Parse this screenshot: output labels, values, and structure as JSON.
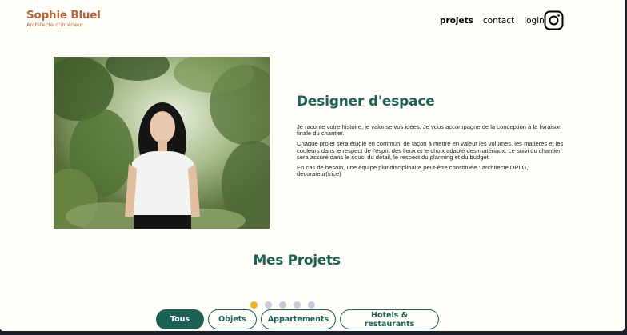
{
  "header": {
    "logo_name": "Sophie Bluel",
    "logo_subtitle": "Architecte d'intérieur",
    "nav": [
      {
        "label": "projets",
        "active": true
      },
      {
        "label": "contact",
        "active": false
      },
      {
        "label": "login",
        "active": false
      }
    ],
    "social_icon": "instagram-icon"
  },
  "intro": {
    "title": "Designer d'espace",
    "paragraphs": [
      "Je raconte votre histoire, je valorise vos idées. Je vous accompagne de la conception à la livraison finale du chantier.",
      "Chaque projet sera étudié en commun, de façon à mettre en valeur les volumes, les matières et les couleurs dans le respect de l'esprit des lieux et le choix adapté des matériaux. Le suivi du chantier sera assuré dans le souci du détail, le respect du planning et du budget.",
      "En cas de besoin, une équipe pluridisciplinaire peut-être constituée : architecte DPLG, décorateur(trice)"
    ]
  },
  "projects": {
    "title": "Mes Projets",
    "carousel_dots": 5,
    "active_dot": 0,
    "filters": [
      {
        "label": "Tous",
        "active": true
      },
      {
        "label": "Objets",
        "active": false
      },
      {
        "label": "Appartements",
        "active": false
      },
      {
        "label": "Hotels & restaurants",
        "active": false
      }
    ]
  },
  "colors": {
    "accent": "#1d6154",
    "brand": "#b1663c",
    "background": "#fffef8",
    "dot_active": "#f2b221",
    "dot_inactive": "#c5ccd8"
  }
}
